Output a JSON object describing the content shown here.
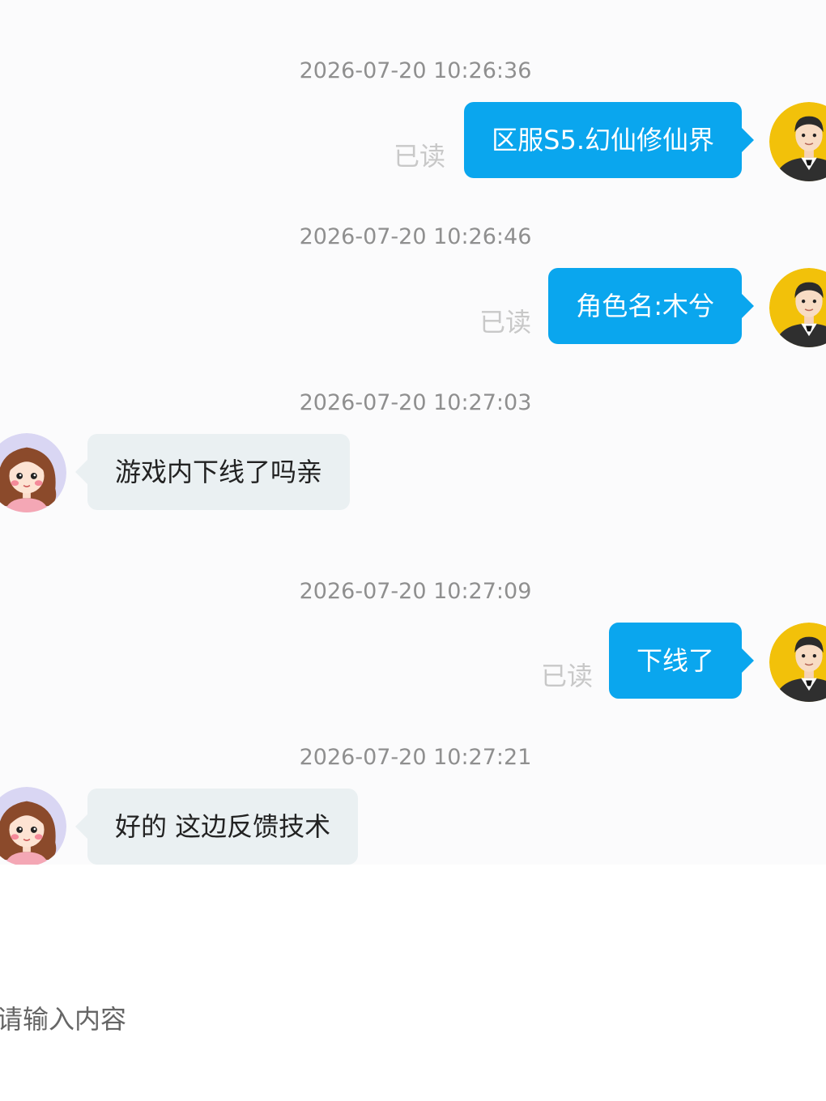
{
  "chat": {
    "read_label": "已读",
    "messages": [
      {
        "timestamp": "2026-07-20 10:26:36",
        "side": "out",
        "text": "区服S5.幻仙修仙界"
      },
      {
        "timestamp": "2026-07-20 10:26:46",
        "side": "out",
        "text": "角色名:木兮"
      },
      {
        "timestamp": "2026-07-20 10:27:03",
        "side": "in",
        "text": "游戏内下线了吗亲"
      },
      {
        "timestamp": "2026-07-20 10:27:09",
        "side": "out",
        "text": "下线了"
      },
      {
        "timestamp": "2026-07-20 10:27:21",
        "side": "in",
        "text": "好的 这边反馈技术"
      }
    ]
  },
  "input": {
    "placeholder": "请输入内容",
    "value": ""
  },
  "colors": {
    "outgoing_bubble": "#0aa6ee",
    "incoming_bubble": "#eaf0f2",
    "user_avatar_bg": "#f2c10a",
    "agent_avatar_bg": "#d9d6f3"
  },
  "icons": {
    "user_avatar": "man-in-suit-avatar-icon",
    "agent_avatar": "girl-avatar-icon"
  }
}
